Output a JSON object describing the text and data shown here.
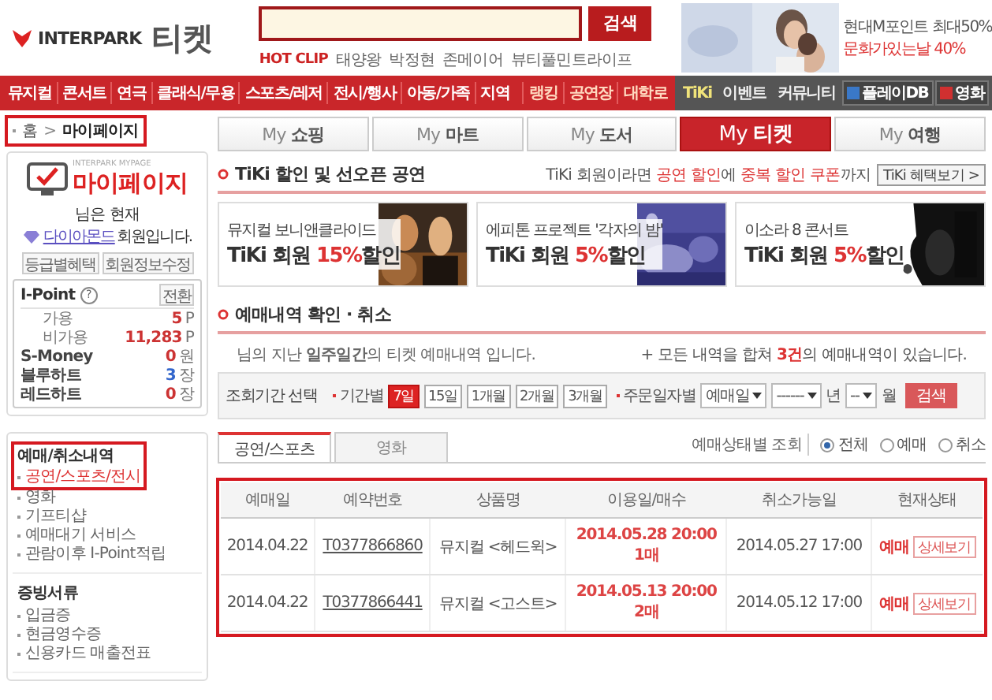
{
  "header": {
    "logo": "INTERPARK",
    "service": "티켓",
    "search": {
      "button": "검색"
    },
    "hot_clip": {
      "label": "HOT CLIP",
      "items": [
        "태양왕",
        "박정현",
        "존메이어",
        "뷰티풀민트라이프"
      ]
    },
    "ad": {
      "lines": [
        "현대M포인트 최대50%",
        "문화가있는날 40%"
      ]
    }
  },
  "nav": {
    "items": [
      "뮤지컬",
      "콘서트",
      "연극",
      "클래식/무용",
      "스포츠/레저",
      "전시/행사",
      "아동/가족",
      "지역"
    ],
    "right_items": [
      "랭킹",
      "공연장",
      "대학로"
    ],
    "tiki_items": [
      "TiKi",
      "이벤트",
      "커뮤니티"
    ],
    "buttons": [
      "플레이DB",
      "영화"
    ]
  },
  "breadcrumb": {
    "home": "홈",
    "separator": ">",
    "current": "마이페이지",
    "highlighted": true
  },
  "mypage": {
    "caption": "INTERPARK MYPAGE",
    "title": "마이페이지",
    "greeting": "님은 현재",
    "grade": "다이아몬드",
    "grade_suffix": "회원입니다.",
    "buttons": [
      "등급별혜택",
      "회원정보수정"
    ],
    "points": {
      "title": "I-Point",
      "help": "?",
      "button": "전환",
      "rows": [
        {
          "label": "가용",
          "value": "5",
          "unit": "P",
          "color": "#cc3333",
          "sub": true
        },
        {
          "label": "비가용",
          "value": "11,283",
          "unit": "P",
          "color": "#cc3333",
          "sub": true
        },
        {
          "label": "S-Money",
          "value": "0",
          "unit": "원",
          "color": "#cc3333",
          "sub": false
        },
        {
          "label": "블루하트",
          "value": "3",
          "unit": "장",
          "color": "#3366cc",
          "sub": false
        },
        {
          "label": "레드하트",
          "value": "0",
          "unit": "장",
          "color": "#cc3333",
          "sub": false
        }
      ]
    }
  },
  "menu": [
    {
      "title": "예매/취소내역",
      "highlighted": true,
      "items": [
        {
          "label": "공연/스포츠/전시",
          "selected": true
        },
        {
          "label": "영화",
          "selected": false
        },
        {
          "label": "기프티샵",
          "selected": false
        },
        {
          "label": "예매대기 서비스",
          "selected": false
        },
        {
          "label": "관람이후 I-Point적립",
          "selected": false
        }
      ]
    },
    {
      "title": "증빙서류",
      "highlighted": false,
      "items": [
        {
          "label": "입금증",
          "selected": false
        },
        {
          "label": "현금영수증",
          "selected": false
        },
        {
          "label": "신용카드 매출전표",
          "selected": false
        }
      ]
    }
  ],
  "tabs": [
    {
      "prefix": "My",
      "label": "쇼핑",
      "selected": false
    },
    {
      "prefix": "My",
      "label": "마트",
      "selected": false
    },
    {
      "prefix": "My",
      "label": "도서",
      "selected": false
    },
    {
      "prefix": "My",
      "label": "티켓",
      "selected": true
    },
    {
      "prefix": "My",
      "label": "여행",
      "selected": false
    }
  ],
  "tiki": {
    "title": "TiKi 할인 및 선오픈 공연",
    "note": [
      {
        "text": "TiKi 회원이라면 ",
        "highlight": false
      },
      {
        "text": "공연 할인",
        "highlight": true
      },
      {
        "text": "에 ",
        "highlight": false
      },
      {
        "text": "중복 할인 쿠폰",
        "highlight": true
      },
      {
        "text": "까지",
        "highlight": false
      }
    ],
    "button": "TiKi 혜택보기 >",
    "banners": [
      {
        "line1": "뮤지컬 보니앤클라이드",
        "member": "TiKi 회원",
        "discount": "15%",
        "suffix": "할인"
      },
      {
        "line1": "에피톤 프로젝트 '각자의 밤'",
        "member": "TiKi 회원",
        "discount": "5%",
        "suffix": "할인"
      },
      {
        "line1": "이소라 8 콘서트",
        "member": "TiKi 회원",
        "discount": "5%",
        "suffix": "할인"
      }
    ]
  },
  "reservations": {
    "title": "예매내역 확인 · 취소",
    "intro": "님의 지난 **일주일간**의 티켓 예매내역 입니다.",
    "summary": [
      {
        "text": "+ 모든 내역을 합쳐 ",
        "highlight": false
      },
      {
        "text": "3건",
        "highlight": true
      },
      {
        "text": "의 예매내역이 있습니다.",
        "highlight": false
      }
    ],
    "filter": {
      "label": "조회기간 선택",
      "period_label": "기간별",
      "periods": [
        {
          "label": "7일",
          "selected": true
        },
        {
          "label": "15일",
          "selected": false
        },
        {
          "label": "1개월",
          "selected": false
        },
        {
          "label": "2개월",
          "selected": false
        },
        {
          "label": "3개월",
          "selected": false
        }
      ],
      "order_label": "주문일자별",
      "date_type": "예매일",
      "year": "------",
      "year_unit": "년",
      "month": "--",
      "month_unit": "월",
      "button": "검색"
    },
    "list_tabs": [
      {
        "label": "공연/스포츠",
        "selected": true
      },
      {
        "label": "영화",
        "selected": false
      }
    ],
    "status_filter": {
      "label": "예매상태별 조회",
      "options": [
        {
          "label": "전체",
          "selected": true
        },
        {
          "label": "예매",
          "selected": false
        },
        {
          "label": "취소",
          "selected": false
        }
      ]
    },
    "table": {
      "highlighted": true,
      "columns": [
        "예매일",
        "예약번호",
        "상품명",
        "이용일/매수",
        "취소가능일",
        "현재상태"
      ],
      "rows": [
        {
          "date": "2014.04.22",
          "number": "T0377866860",
          "title": "뮤지컬 <헤드윅>",
          "use_date": "2014.05.28 20:00",
          "count": "1매",
          "cancel_by": "2014.05.27 17:00",
          "status": "예매",
          "detail": "상세보기"
        },
        {
          "date": "2014.04.22",
          "number": "T0377866441",
          "title": "뮤지컬 <고스트>",
          "use_date": "2014.05.13 20:00",
          "count": "2매",
          "cancel_by": "2014.05.12 17:00",
          "status": "예매",
          "detail": "상세보기"
        }
      ]
    }
  }
}
